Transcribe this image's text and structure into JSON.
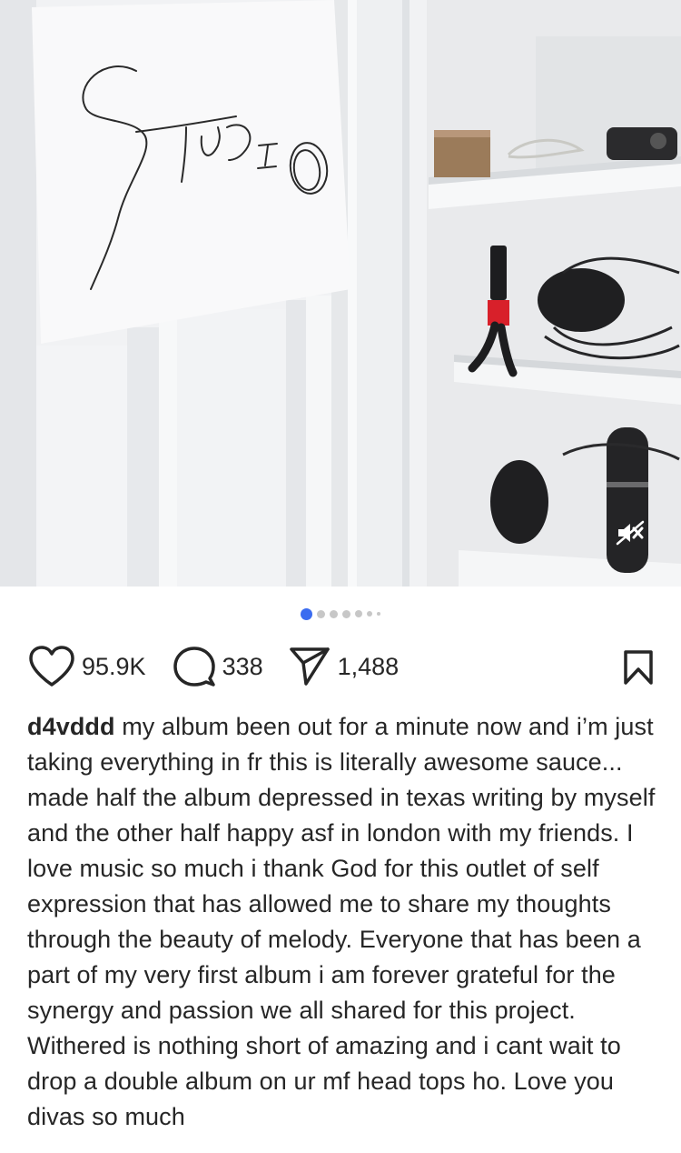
{
  "post": {
    "image_handwriting": "STUDIO",
    "mute_icon": "speaker-muted-icon",
    "carousel": {
      "total": 7,
      "active_index": 0
    },
    "likes": "95.9K",
    "comments": "338",
    "shares": "1,488",
    "username": "d4vddd",
    "caption": "my album been out for a minute now and i’m just taking everything in fr this is literally awesome sauce... made half the album depressed in texas writing by myself and the other half happy asf in london with my friends. I love music so much i thank God for this outlet of self expression that has allowed me to share my thoughts through the beauty of melody. Everyone that has been a part of my very first album i am forever grateful for the synergy and passion we all shared for this project. Withered is nothing short of amazing and i cant wait to drop a double album on ur mf head tops ho. Love you divas so much"
  },
  "icons": {
    "like": "heart-icon",
    "comment": "comment-bubble-icon",
    "share": "paper-plane-icon",
    "save": "bookmark-icon"
  },
  "colors": {
    "accent": "#3b6cf0",
    "text": "#262626",
    "inactive_dot": "#c7c7c7"
  }
}
